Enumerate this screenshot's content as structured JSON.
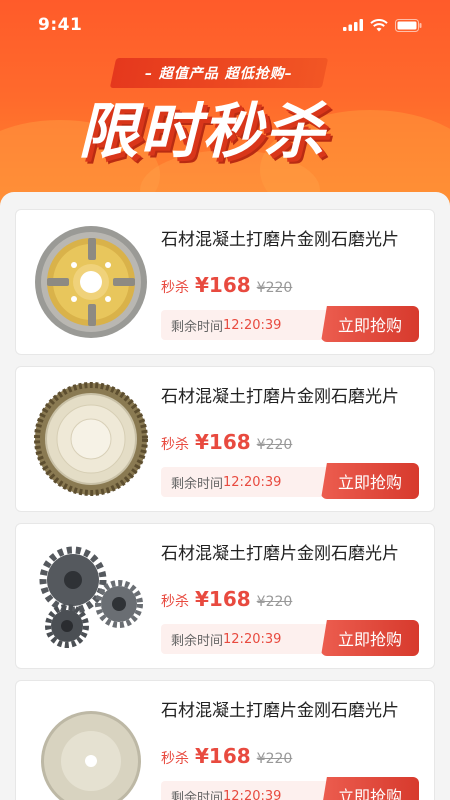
{
  "status": {
    "time": "9:41"
  },
  "banner": {
    "subtitle": "– 超值产品  超低抢购–",
    "title": "限时秒杀"
  },
  "products": [
    {
      "title": "石材混凝土打磨片金刚石磨光片",
      "price_label": "秒杀",
      "price": "¥168",
      "old_price": "¥220",
      "countdown_label": "剩余时间",
      "countdown": "12:20:39",
      "buy_label": "立即抢购",
      "image_icon": "grinding-cup-wheel"
    },
    {
      "title": "石材混凝土打磨片金刚石磨光片",
      "price_label": "秒杀",
      "price": "¥168",
      "old_price": "¥220",
      "countdown_label": "剩余时间",
      "countdown": "12:20:39",
      "buy_label": "立即抢购",
      "image_icon": "diamond-saw-blade"
    },
    {
      "title": "石材混凝土打磨片金刚石磨光片",
      "price_label": "秒杀",
      "price": "¥168",
      "old_price": "¥220",
      "countdown_label": "剩余时间",
      "countdown": "12:20:39",
      "buy_label": "立即抢购",
      "image_icon": "gear-set"
    },
    {
      "title": "石材混凝土打磨片金刚石磨光片",
      "price_label": "秒杀",
      "price": "¥168",
      "old_price": "¥220",
      "countdown_label": "剩余时间",
      "countdown": "12:20:39",
      "buy_label": "立即抢购",
      "image_icon": "thin-cutting-disc"
    }
  ],
  "colors": {
    "accent": "#e84a3f",
    "banner": "#ff6a2c"
  }
}
